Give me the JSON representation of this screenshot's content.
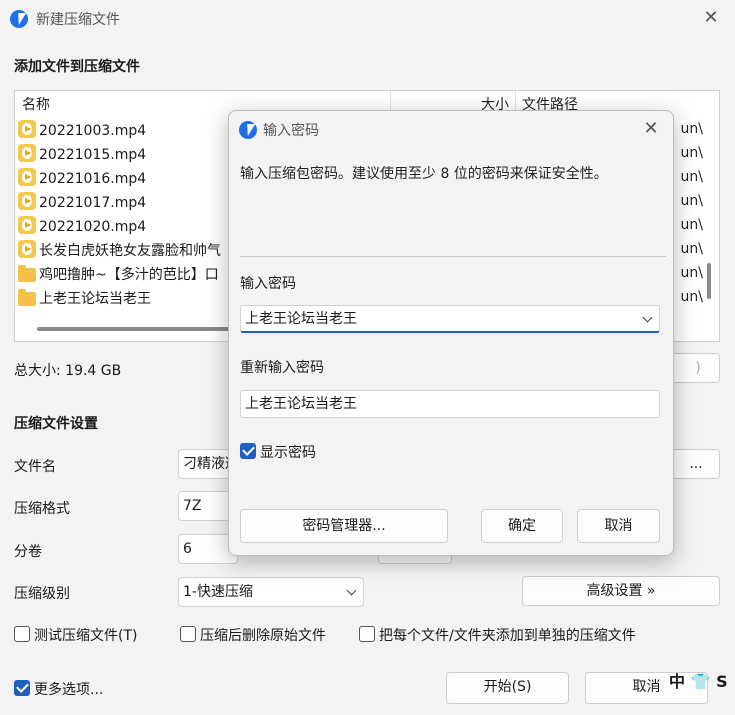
{
  "window": {
    "title": "新建压缩文件"
  },
  "add_section": {
    "title": "添加文件到压缩文件"
  },
  "file_list": {
    "columns": {
      "name": "名称",
      "size": "大小",
      "path": "文件路径"
    },
    "rows": [
      {
        "name": "20221003.mp4",
        "type": "video",
        "path_fragment": "un\\"
      },
      {
        "name": "20221015.mp4",
        "type": "video",
        "path_fragment": "un\\"
      },
      {
        "name": "20221016.mp4",
        "type": "video",
        "path_fragment": "un\\"
      },
      {
        "name": "20221017.mp4",
        "type": "video",
        "path_fragment": "un\\"
      },
      {
        "name": "20221020.mp4",
        "type": "video",
        "path_fragment": "un\\"
      },
      {
        "name": "长发白虎妖艳女友露脸和帅气",
        "type": "video",
        "path_fragment": "un\\"
      },
      {
        "name": "鸡吧撸肿~【多汁的芭比】口",
        "type": "folder",
        "path_fragment": "un\\"
      },
      {
        "name": "上老王论坛当老王",
        "type": "folder",
        "path_fragment": "un\\"
      }
    ]
  },
  "total_size": "总大小: 19.4 GB",
  "hidden_button_fragment": ")",
  "settings": {
    "title": "压缩文件设置",
    "filename_label": "文件名",
    "filename_value": "刁精液迦",
    "browse_label": "...",
    "format_label": "压缩格式",
    "format_value": "7Z",
    "volume_label": "分卷",
    "volume_value": "6",
    "level_label": "压缩级别",
    "level_value": "1-快速压缩",
    "advanced_button": "高级设置 »"
  },
  "options": {
    "test_archive": {
      "label": "测试压缩文件(T)",
      "checked": false
    },
    "delete_after": {
      "label": "压缩后删除原始文件",
      "checked": false
    },
    "separate_archives": {
      "label": "把每个文件/文件夹添加到单独的压缩文件",
      "checked": false
    },
    "more_options": {
      "label": "更多选项...",
      "checked": true
    }
  },
  "footer": {
    "start_button": "开始(S)",
    "cancel_button": "取消"
  },
  "edge_fragment": "中 👕 S",
  "password_dialog": {
    "title": "输入密码",
    "description": "输入压缩包密码。建议使用至少 8 位的密码来保证安全性。",
    "password_label": "输入密码",
    "password_value": "上老王论坛当老王",
    "confirm_label": "重新输入密码",
    "confirm_value": "上老王论坛当老王",
    "show_password": {
      "label": "显示密码",
      "checked": true
    },
    "manager_button": "密码管理器...",
    "ok_button": "确定",
    "cancel_button": "取消"
  },
  "colors": {
    "accent": "#1f5fbf",
    "logo": "#1f6feb",
    "video_icon": "#f2c94c",
    "folder_icon": "#f4c04a"
  }
}
